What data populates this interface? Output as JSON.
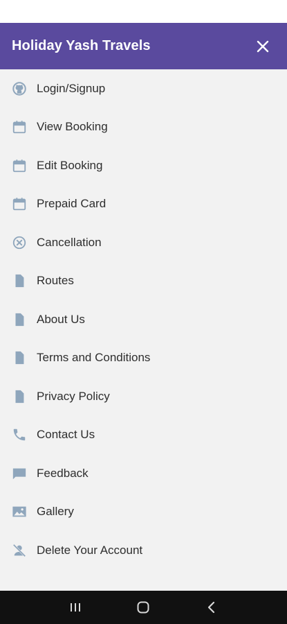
{
  "header": {
    "title": "Holiday Yash Travels",
    "close_icon": "close-icon"
  },
  "colors": {
    "header_bg": "#5a4a9e",
    "drawer_bg": "#f2f2f2",
    "icon": "#8fa6bc",
    "text": "#2e2e2e",
    "nav_bar": "#111111"
  },
  "menu": {
    "items": [
      {
        "label": "Login/Signup",
        "icon": "github-icon"
      },
      {
        "label": "View Booking",
        "icon": "calendar-icon"
      },
      {
        "label": "Edit Booking",
        "icon": "calendar-icon"
      },
      {
        "label": "Prepaid Card",
        "icon": "calendar-icon"
      },
      {
        "label": "Cancellation",
        "icon": "cancel-circle-icon"
      },
      {
        "label": "Routes",
        "icon": "document-icon"
      },
      {
        "label": "About Us",
        "icon": "document-icon"
      },
      {
        "label": "Terms and Conditions",
        "icon": "document-icon"
      },
      {
        "label": "Privacy Policy",
        "icon": "document-icon"
      },
      {
        "label": "Contact Us",
        "icon": "phone-icon"
      },
      {
        "label": "Feedback",
        "icon": "chat-icon"
      },
      {
        "label": "Gallery",
        "icon": "image-icon"
      },
      {
        "label": "Delete Your Account",
        "icon": "remove-user-icon"
      }
    ]
  },
  "nav_bar": {
    "buttons": [
      "recent-apps-icon",
      "home-icon",
      "back-icon"
    ]
  }
}
